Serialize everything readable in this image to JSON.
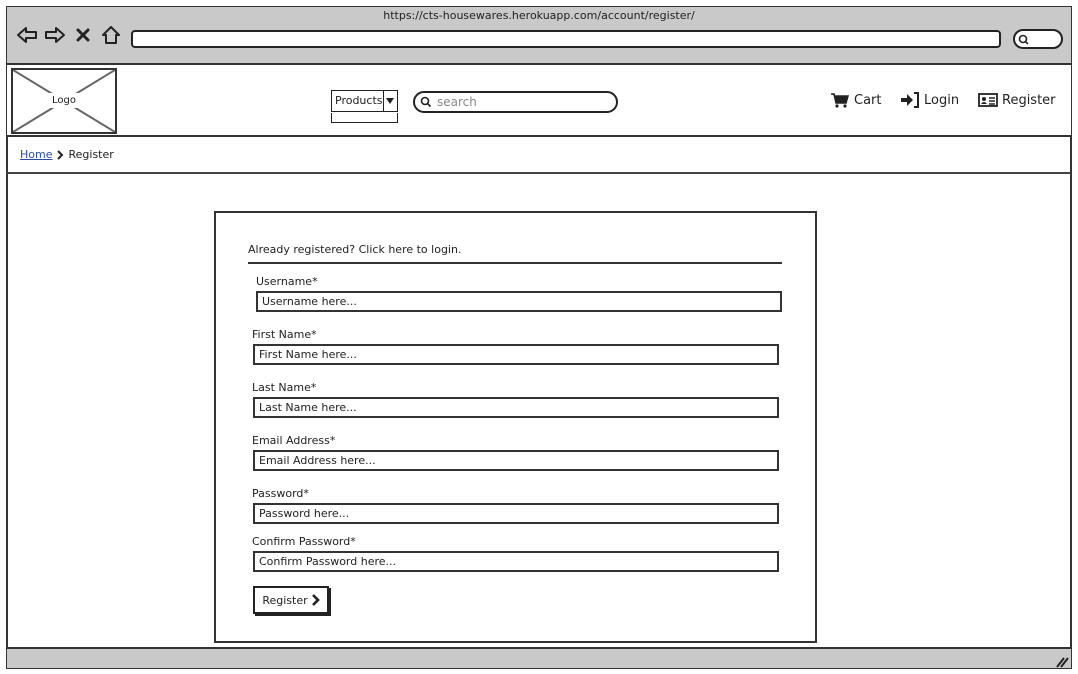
{
  "browser": {
    "url": "https://cts-housewares.herokuapp.com/account/register/"
  },
  "header": {
    "logo_label": "Logo",
    "products_label": "Products",
    "search_placeholder": "search",
    "cart_label": "Cart",
    "login_label": "Login",
    "register_label": "Register"
  },
  "breadcrumb": {
    "home": "Home",
    "current": "Register"
  },
  "form": {
    "login_prompt": "Already registered? Click here to login.",
    "fields": [
      {
        "label": "Username*",
        "placeholder": "Username here..."
      },
      {
        "label": "First Name*",
        "placeholder": "First Name here..."
      },
      {
        "label": "Last Name*",
        "placeholder": "Last Name here..."
      },
      {
        "label": "Email Address*",
        "placeholder": "Email Address here..."
      },
      {
        "label": "Password*",
        "placeholder": "Password here..."
      },
      {
        "label": "Confirm Password*",
        "placeholder": "Confirm Password here..."
      }
    ],
    "submit_label": "Register"
  }
}
